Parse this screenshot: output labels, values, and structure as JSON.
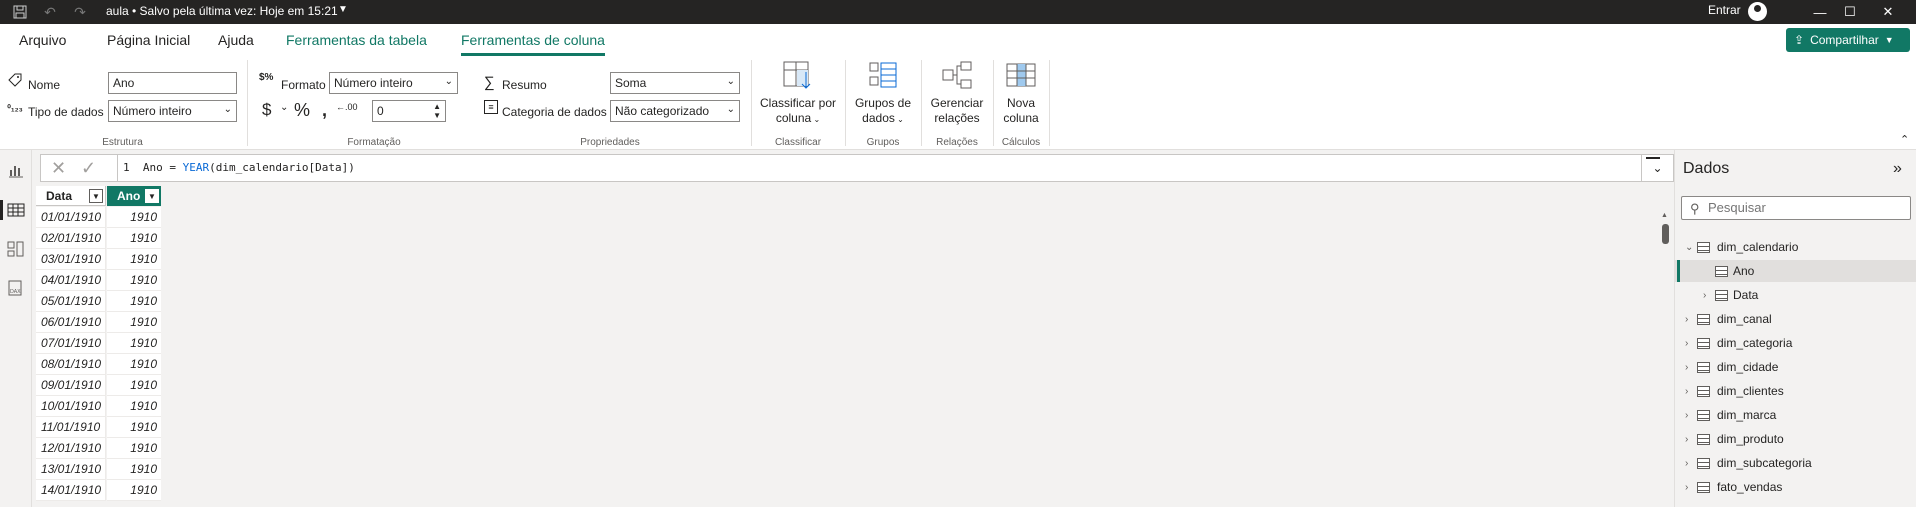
{
  "titlebar": {
    "title": "aula • Salvo pela última vez: Hoje em 15:21",
    "signin": "Entrar",
    "icons": [
      "save-icon",
      "undo-icon",
      "redo-icon"
    ]
  },
  "menu": {
    "tabs": [
      "Arquivo",
      "Página Inicial",
      "Ajuda",
      "Ferramentas da tabela",
      "Ferramentas de coluna"
    ],
    "active": "Ferramentas de coluna",
    "share": "Compartilhar"
  },
  "ribbon": {
    "estrutura": {
      "name_label": "Nome",
      "name_value": "Ano",
      "datatype_label": "Tipo de dados",
      "datatype_value": "Número inteiro",
      "group": "Estrutura"
    },
    "formatacao": {
      "format_label": "Formato",
      "format_value": "Número inteiro",
      "decimals_value": "0",
      "group": "Formatação"
    },
    "propriedades": {
      "summary_label": "Resumo",
      "summary_value": "Soma",
      "category_label": "Categoria de dados",
      "category_value": "Não categorizado",
      "group": "Propriedades"
    },
    "classificar": {
      "btn_line1": "Classificar por",
      "btn_line2": "coluna",
      "group": "Classificar"
    },
    "grupos": {
      "btn_line1": "Grupos de",
      "btn_line2": "dados",
      "group": "Grupos"
    },
    "relacoes": {
      "btn_line1": "Gerenciar",
      "btn_line2": "relações",
      "group": "Relações"
    },
    "calculos": {
      "btn_line1": "Nova",
      "btn_line2": "coluna",
      "group": "Cálculos"
    }
  },
  "formula": {
    "line": "1",
    "prefix": "Ano = ",
    "fn": "YEAR",
    "rest": "(dim_calendario[Data])"
  },
  "table": {
    "headers": [
      "Data",
      "Ano"
    ],
    "rows": [
      [
        "01/01/1910",
        "1910"
      ],
      [
        "02/01/1910",
        "1910"
      ],
      [
        "03/01/1910",
        "1910"
      ],
      [
        "04/01/1910",
        "1910"
      ],
      [
        "05/01/1910",
        "1910"
      ],
      [
        "06/01/1910",
        "1910"
      ],
      [
        "07/01/1910",
        "1910"
      ],
      [
        "08/01/1910",
        "1910"
      ],
      [
        "09/01/1910",
        "1910"
      ],
      [
        "10/01/1910",
        "1910"
      ],
      [
        "11/01/1910",
        "1910"
      ],
      [
        "12/01/1910",
        "1910"
      ],
      [
        "13/01/1910",
        "1910"
      ],
      [
        "14/01/1910",
        "1910"
      ]
    ]
  },
  "datapane": {
    "title": "Dados",
    "search_placeholder": "Pesquisar",
    "tables": [
      {
        "name": "dim_calendario",
        "expanded": true,
        "fields": [
          "Ano",
          "Data"
        ]
      },
      {
        "name": "dim_canal"
      },
      {
        "name": "dim_categoria"
      },
      {
        "name": "dim_cidade"
      },
      {
        "name": "dim_clientes"
      },
      {
        "name": "dim_marca"
      },
      {
        "name": "dim_produto"
      },
      {
        "name": "dim_subcategoria"
      },
      {
        "name": "fato_vendas"
      }
    ]
  },
  "colors": {
    "accent": "#117865",
    "titlebar": "#252423",
    "function": "#0a6ad6"
  }
}
